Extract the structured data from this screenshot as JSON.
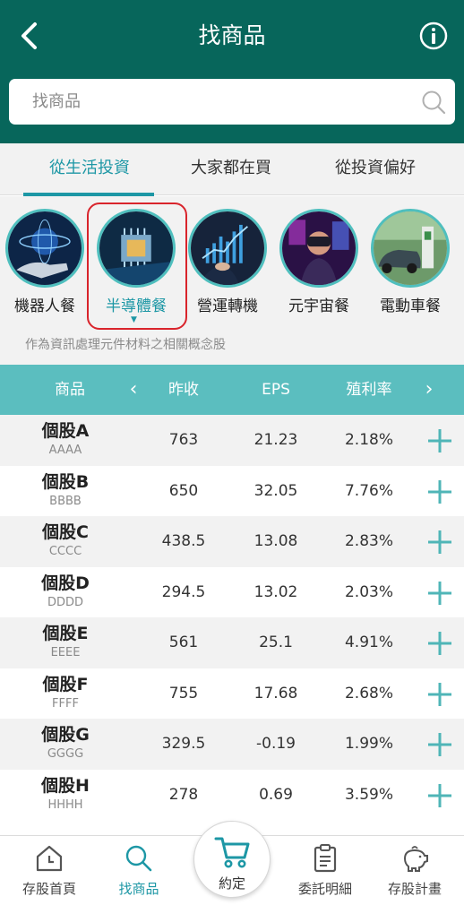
{
  "header": {
    "title": "找商品"
  },
  "search": {
    "placeholder": "找商品"
  },
  "tabs": [
    {
      "label": "從生活投資",
      "active": true
    },
    {
      "label": "大家都在買",
      "active": false
    },
    {
      "label": "從投資偏好",
      "active": false
    }
  ],
  "categories": [
    {
      "label": "機器人餐",
      "icon": "robot-hand-image"
    },
    {
      "label": "半導體餐",
      "icon": "chip-image",
      "selected": true
    },
    {
      "label": "營運轉機",
      "icon": "business-chart-image"
    },
    {
      "label": "元宇宙餐",
      "icon": "vr-headset-image"
    },
    {
      "label": "電動車餐",
      "icon": "ev-charging-image"
    }
  ],
  "category_description": "作為資訊處理元件材料之相關概念股",
  "table": {
    "headers": {
      "product": "商品",
      "prev_close": "昨收",
      "eps": "EPS",
      "yield": "殖利率"
    },
    "rows": [
      {
        "name": "個股A",
        "code": "AAAA",
        "prev_close": "763",
        "eps": "21.23",
        "yield": "2.18%"
      },
      {
        "name": "個股B",
        "code": "BBBB",
        "prev_close": "650",
        "eps": "32.05",
        "yield": "7.76%"
      },
      {
        "name": "個股C",
        "code": "CCCC",
        "prev_close": "438.5",
        "eps": "13.08",
        "yield": "2.83%"
      },
      {
        "name": "個股D",
        "code": "DDDD",
        "prev_close": "294.5",
        "eps": "13.02",
        "yield": "2.03%"
      },
      {
        "name": "個股E",
        "code": "EEEE",
        "prev_close": "561",
        "eps": "25.1",
        "yield": "4.91%"
      },
      {
        "name": "個股F",
        "code": "FFFF",
        "prev_close": "755",
        "eps": "17.68",
        "yield": "2.68%"
      },
      {
        "name": "個股G",
        "code": "GGGG",
        "prev_close": "329.5",
        "eps": "-0.19",
        "yield": "1.99%"
      },
      {
        "name": "個股H",
        "code": "HHHH",
        "prev_close": "278",
        "eps": "0.69",
        "yield": "3.59%"
      }
    ]
  },
  "bottom_nav": [
    {
      "label": "存股首頁",
      "icon": "home-icon",
      "active": false
    },
    {
      "label": "找商品",
      "icon": "search-icon",
      "active": true
    },
    {
      "label": "約定",
      "icon": "cart-icon",
      "active": false
    },
    {
      "label": "委託明細",
      "icon": "clipboard-icon",
      "active": false
    },
    {
      "label": "存股計畫",
      "icon": "piggy-bank-icon",
      "active": false
    }
  ],
  "colors": {
    "header_bg": "#07665b",
    "accent": "#1d97a5",
    "table_header_bg": "#5bbebf",
    "highlight_border": "#d9242c"
  }
}
